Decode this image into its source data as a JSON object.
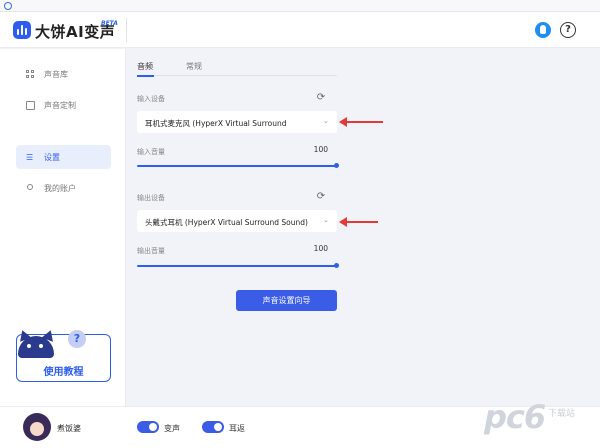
{
  "app": {
    "title": "大饼AI变声",
    "badge": "BETA"
  },
  "header": {
    "icons": [
      "qq-icon",
      "help-icon"
    ],
    "help_glyph": "?"
  },
  "sidebar": {
    "items": [
      {
        "label": "声音库",
        "icon": "grid-icon",
        "active": false
      },
      {
        "label": "声音定制",
        "icon": "bag-icon",
        "active": false
      },
      {
        "label": "设置",
        "icon": "sliders-icon",
        "active": true
      },
      {
        "label": "我的账户",
        "icon": "user-icon",
        "active": false
      }
    ],
    "tutorial_label": "使用教程",
    "bubble_glyph": "?"
  },
  "settings": {
    "tabs": [
      {
        "label": "音频",
        "active": true
      },
      {
        "label": "常规",
        "active": false
      }
    ],
    "input": {
      "section_label": "输入设备",
      "device": "耳机式麦克风 (HyperX Virtual Surround",
      "volume_label": "输入音量",
      "volume_value": "100",
      "volume_fraction": 1.0
    },
    "output": {
      "section_label": "输出设备",
      "device": "头戴式耳机 (HyperX Virtual Surround Sound)",
      "volume_label": "输出音量",
      "volume_value": "100",
      "volume_fraction": 1.0
    },
    "wizard_button": "声音设置向导"
  },
  "bottombar": {
    "username": "煮饭婆",
    "toggles": [
      {
        "label": "变声",
        "on": true
      },
      {
        "label": "耳返",
        "on": true
      }
    ]
  },
  "watermark": {
    "brand": "pc6",
    "sub": "下载站"
  },
  "colors": {
    "accent": "#2d5ef0",
    "button": "#3b5ce6",
    "annotation_arrow": "#e53935"
  }
}
